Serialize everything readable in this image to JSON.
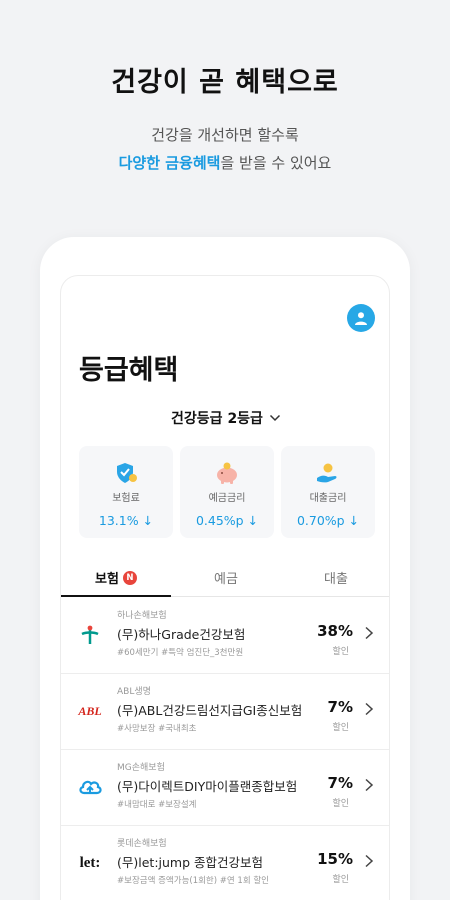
{
  "promo": {
    "headline": "건강이 곧 혜택으로",
    "sub_line1": "건강을 개선하면 할수록",
    "sub_accent": "다양한 금융혜택",
    "sub_rest": "을 받을 수 있어요"
  },
  "app": {
    "page_title": "등급혜택",
    "grade_label": "건강등급 2등급",
    "benefit_cards": [
      {
        "label": "보험료",
        "value": "13.1% ↓",
        "icon": "insurance-shield-icon"
      },
      {
        "label": "예금금리",
        "value": "0.45%p ↓",
        "icon": "piggy-bank-icon"
      },
      {
        "label": "대출금리",
        "value": "0.70%p ↓",
        "icon": "hand-coin-icon"
      }
    ],
    "tabs": [
      {
        "label": "보험",
        "badge": "N",
        "active": true
      },
      {
        "label": "예금",
        "active": false
      },
      {
        "label": "대출",
        "active": false
      }
    ],
    "products": [
      {
        "company": "하나손해보험",
        "name": "(무)하나Grade건강보험",
        "tags": "#60세만기 #특약 엄진단_3천만원",
        "discount": "38%",
        "discount_label": "할인",
        "logo": "hana-logo-icon"
      },
      {
        "company": "ABL생명",
        "name": "(무)ABL건강드림선지급GI종신보험",
        "tags": "#사망보장 #국내최초",
        "discount": "7%",
        "discount_label": "할인",
        "logo": "abl-logo-icon",
        "logo_text": "ABL"
      },
      {
        "company": "MG손해보험",
        "name": "(무)다이렉트DIY마이플랜종합보험",
        "tags": "#내맘대로 #보장설계",
        "discount": "7%",
        "discount_label": "할인",
        "logo": "mg-logo-icon"
      },
      {
        "company": "롯데손해보험",
        "name": "(무)let:jump 종합건강보험",
        "tags": "#보장금액 증액가능(1회한) #연 1회 할인",
        "discount": "15%",
        "discount_label": "할인",
        "logo": "lotte-let-logo-icon",
        "logo_text": "let:"
      }
    ]
  },
  "colors": {
    "accent": "#1a9be0",
    "badge": "#e8453c",
    "abl_red": "#d4251c",
    "hana_green": "#009a8e"
  }
}
